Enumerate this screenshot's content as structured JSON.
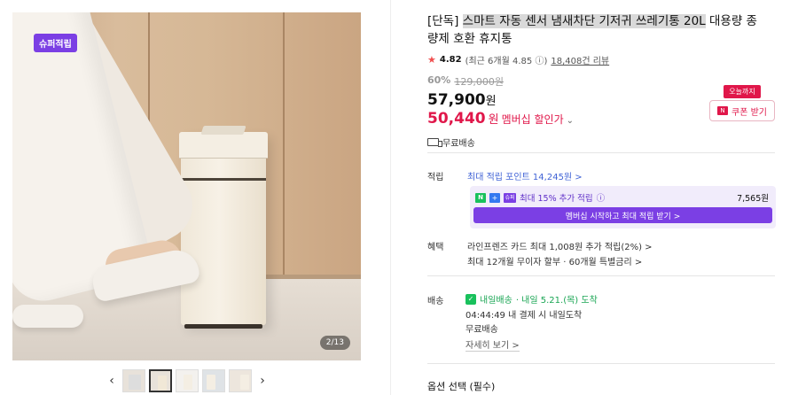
{
  "gallery": {
    "badge": "슈퍼적립",
    "counter": "2/13",
    "prev_icon": "‹",
    "next_icon": "›",
    "thumbnails": [
      "thumb-1",
      "thumb-2",
      "thumb-3",
      "thumb-4",
      "thumb-5"
    ],
    "active_thumbnail_index": 1
  },
  "product": {
    "title_prefix": "[단독]",
    "title_highlight": "스마트 자동 센서 냄새차단 기저귀 쓰레기통 20L",
    "title_rest": " 대용량 종량제 호환 휴지통",
    "rating": "4.82",
    "rating_recent": "(최근 6개월 4.85",
    "info_icon": "ⓘ",
    "rating_close": ")",
    "review_count": "18,408건 리뷰",
    "discount_rate": "60%",
    "original_price": "129,000원",
    "price": "57,900",
    "price_unit": "원",
    "member_price": "50,440",
    "member_price_unit": "원",
    "member_price_label": "멤버십 할인가",
    "member_price_chevron": "⌄",
    "shipping": "무료배송"
  },
  "coupon": {
    "tag": "오늘까지",
    "label": "쿠폰 받기",
    "icon": "N"
  },
  "points": {
    "label": "적립",
    "max_points": "최대 적립 포인트 14,245원 >",
    "member_extra": "최대 15% 추가 적립",
    "member_amount": "7,565원",
    "member_cta": "멤버십 시작하고 최대 적립 받기 >",
    "logo_n": "N",
    "logo_plus": "+",
    "logo_u": "슈퍼"
  },
  "benefits": {
    "label": "혜택",
    "line1": "라인프렌즈 카드 최대 1,008원 추가 적립(2%) >",
    "line2": "최대 12개월 무이자 할부 · 60개월 특별금리 >"
  },
  "delivery": {
    "label": "배송",
    "tomorrow_label": "내일배송",
    "arrival": "· 내일 5.21.(목) 도착",
    "countdown": "04:44:49  내 결제 시 내일도착",
    "fee": "무료배송",
    "details_link": "자세히 보기 >"
  },
  "options": {
    "title": "옵션 선택 (필수)"
  },
  "colors": {
    "accent": "#7b3fe4",
    "sale": "#e0174a",
    "link": "#4264d6",
    "green": "#19a553"
  }
}
